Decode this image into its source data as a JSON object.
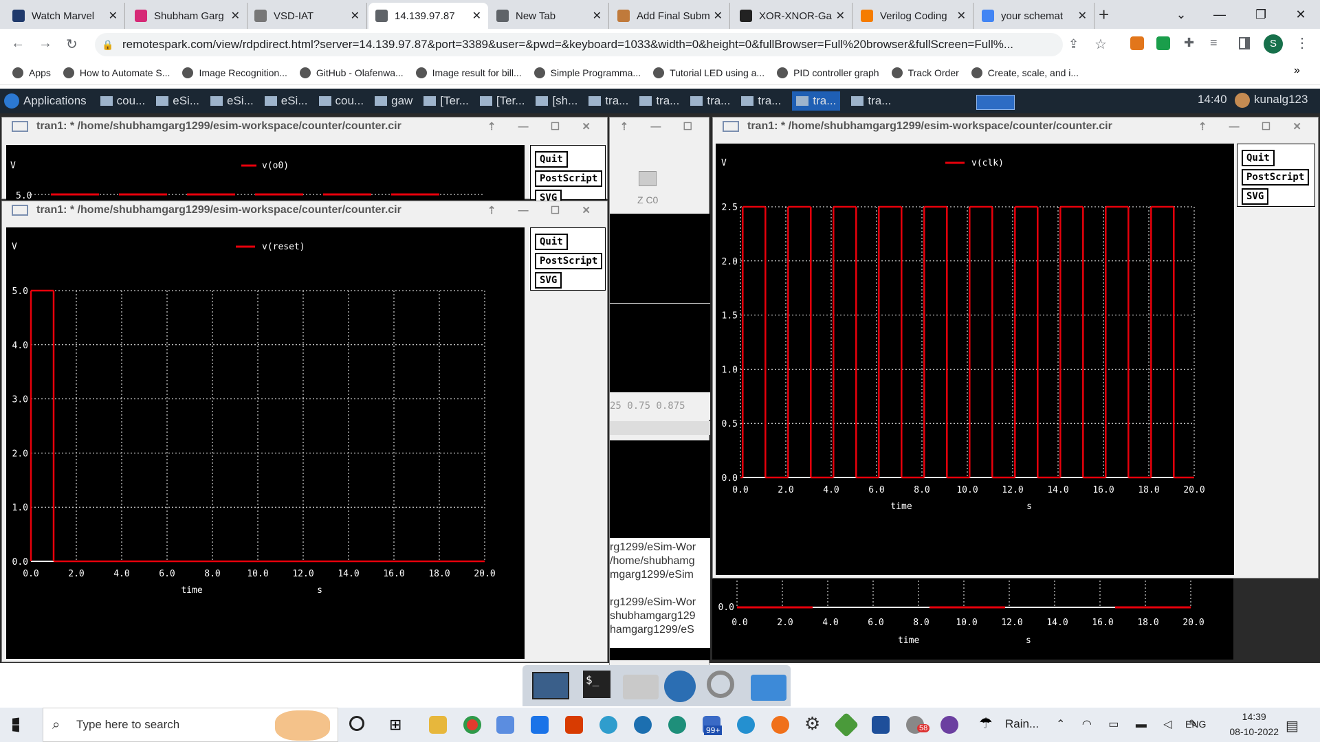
{
  "browser": {
    "tabs": [
      {
        "title": "Watch Marvel",
        "color": "#203a6c"
      },
      {
        "title": "Shubham Garg",
        "color": "#d62976"
      },
      {
        "title": "VSD-IAT",
        "color": "#777"
      },
      {
        "title": "14.139.97.87",
        "color": "#5f6368"
      },
      {
        "title": "New Tab",
        "color": "#5f6368"
      },
      {
        "title": "Add Final Subm",
        "color": "#c07a3b"
      },
      {
        "title": "XOR-XNOR-Gat",
        "color": "#222"
      },
      {
        "title": "Verilog Coding",
        "color": "#f57c00"
      },
      {
        "title": "your schemat",
        "color": "#4285f4"
      }
    ],
    "new_tab": "+",
    "url": "remotespark.com/view/rdpdirect.html?server=14.139.97.87&port=3389&user=&pwd=&keyboard=1033&width=0&height=0&fullBrowser=Full%20browser&fullScreen=Full%...",
    "profile": "S",
    "bookmarks": [
      "Apps",
      "How to Automate S...",
      "Image Recognition...",
      "GitHub - Olafenwa...",
      "Image result for bill...",
      "Simple Programma...",
      "Tutorial LED using a...",
      "PID controller graph",
      "Track Order",
      "Create, scale, and i..."
    ],
    "more_bookmarks": "»"
  },
  "xfce": {
    "menu": "Applications",
    "tasks": [
      "cou...",
      "eSi...",
      "eSi...",
      "eSi...",
      "cou...",
      "gaw",
      "[Ter...",
      "[Ter...",
      "[sh...",
      "tra...",
      "tra...",
      "tra...",
      "tra...",
      "tra...",
      "tra..."
    ],
    "time": "14:40",
    "user": "kunalg123"
  },
  "windows": {
    "title": "tran1: * /home/shubhamgarg1299/esim-workspace/counter/counter.cir",
    "buttons": {
      "quit": "Quit",
      "ps": "PostScript",
      "svg": "SVG"
    },
    "zc0": "Z C0",
    "axis_frag": "25   0.75   0.875",
    "term_lines": [
      "rg1299/eSim-Wor",
      "/home/shubhamg",
      "mgarg1299/eSim",
      "",
      "rg1299/eSim-Wor",
      "shubhamgarg129",
      "hamgarg1299/eS"
    ],
    "time_label": "time",
    "unit_label": "s",
    "v_label": "V"
  },
  "chart_data": [
    {
      "type": "line",
      "name": "v(reset)",
      "color": "#e8000b",
      "ylabel": "V",
      "xlabel": "time",
      "xunit": "s",
      "xlim": [
        0,
        20
      ],
      "ylim": [
        0,
        5
      ],
      "xticks": [
        "0.0",
        "2.0",
        "4.0",
        "6.0",
        "8.0",
        "10.0",
        "12.0",
        "14.0",
        "16.0",
        "18.0",
        "20.0"
      ],
      "yticks": [
        "0.0",
        "1.0",
        "2.0",
        "3.0",
        "4.0",
        "5.0"
      ],
      "x": [
        0,
        0,
        1,
        1,
        20
      ],
      "y": [
        0,
        5,
        5,
        0,
        0
      ]
    },
    {
      "type": "line",
      "name": "v(clk)",
      "color": "#e8000b",
      "ylabel": "V",
      "xlabel": "time",
      "xunit": "s",
      "xlim": [
        0,
        20
      ],
      "ylim": [
        0,
        2.5
      ],
      "xticks": [
        "0.0",
        "2.0",
        "4.0",
        "6.0",
        "8.0",
        "10.0",
        "12.0",
        "14.0",
        "16.0",
        "18.0",
        "20.0"
      ],
      "yticks": [
        "0.0",
        "0.5",
        "1.0",
        "1.5",
        "2.0",
        "2.5"
      ],
      "x": [
        0,
        0.1,
        0.1,
        1.1,
        1.1,
        2.1,
        2.1,
        3.1,
        3.1,
        4.1,
        4.1,
        5.1,
        5.1,
        6.1,
        6.1,
        7.1,
        7.1,
        8.1,
        8.1,
        9.1,
        9.1,
        10.1,
        10.1,
        11.1,
        11.1,
        12.1,
        12.1,
        13.1,
        13.1,
        14.1,
        14.1,
        15.1,
        15.1,
        16.1,
        16.1,
        17.1,
        17.1,
        18.1,
        18.1,
        19.1,
        19.1,
        20
      ],
      "y": [
        0,
        0,
        2.5,
        2.5,
        0,
        0,
        2.5,
        2.5,
        0,
        0,
        2.5,
        2.5,
        0,
        0,
        2.5,
        2.5,
        0,
        0,
        2.5,
        2.5,
        0,
        0,
        2.5,
        2.5,
        0,
        0,
        2.5,
        2.5,
        0,
        0,
        2.5,
        2.5,
        0,
        0,
        2.5,
        2.5,
        0,
        0,
        2.5,
        2.5,
        0,
        0
      ]
    },
    {
      "type": "line",
      "name": "v(o0)",
      "color": "#e8000b",
      "ylabel": "V",
      "xlim": [
        0,
        20
      ],
      "ylim": [
        0,
        5
      ],
      "yticks": [
        "5.0"
      ],
      "x": [
        0,
        20
      ],
      "y": [
        5,
        5
      ]
    }
  ],
  "windows_taskbar": {
    "search_placeholder": "Type here to search",
    "weather": "Rain...",
    "lang": "ENG",
    "time": "14:39",
    "date": "08-10-2022",
    "badge": "99+",
    "notif": "58"
  }
}
